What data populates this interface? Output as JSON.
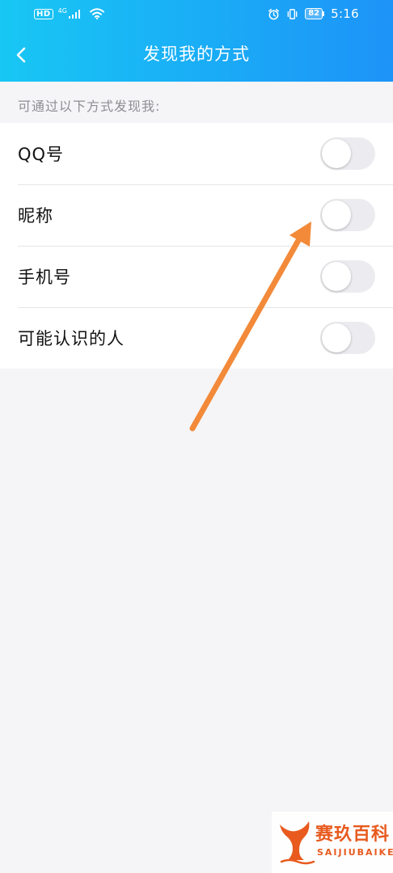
{
  "status_bar": {
    "hd": "HD",
    "network": "4G",
    "battery": "82",
    "time": "5:16"
  },
  "title_bar": {
    "title": "发现我的方式"
  },
  "section": {
    "header": "可通过以下方式发现我:"
  },
  "settings": [
    {
      "label": "QQ号",
      "enabled": false
    },
    {
      "label": "昵称",
      "enabled": false
    },
    {
      "label": "手机号",
      "enabled": false
    },
    {
      "label": "可能认识的人",
      "enabled": false
    }
  ],
  "watermark": {
    "brand_cn": "赛玖百科",
    "brand_en": "SAIJIUBAIKE"
  },
  "colors": {
    "header_gradient_start": "#18c7f4",
    "header_gradient_end": "#1d93f8",
    "background": "#f5f5f7",
    "toggle_off": "#ececf0",
    "annotation_arrow": "#f28a3a",
    "watermark": "#e85a1e"
  }
}
